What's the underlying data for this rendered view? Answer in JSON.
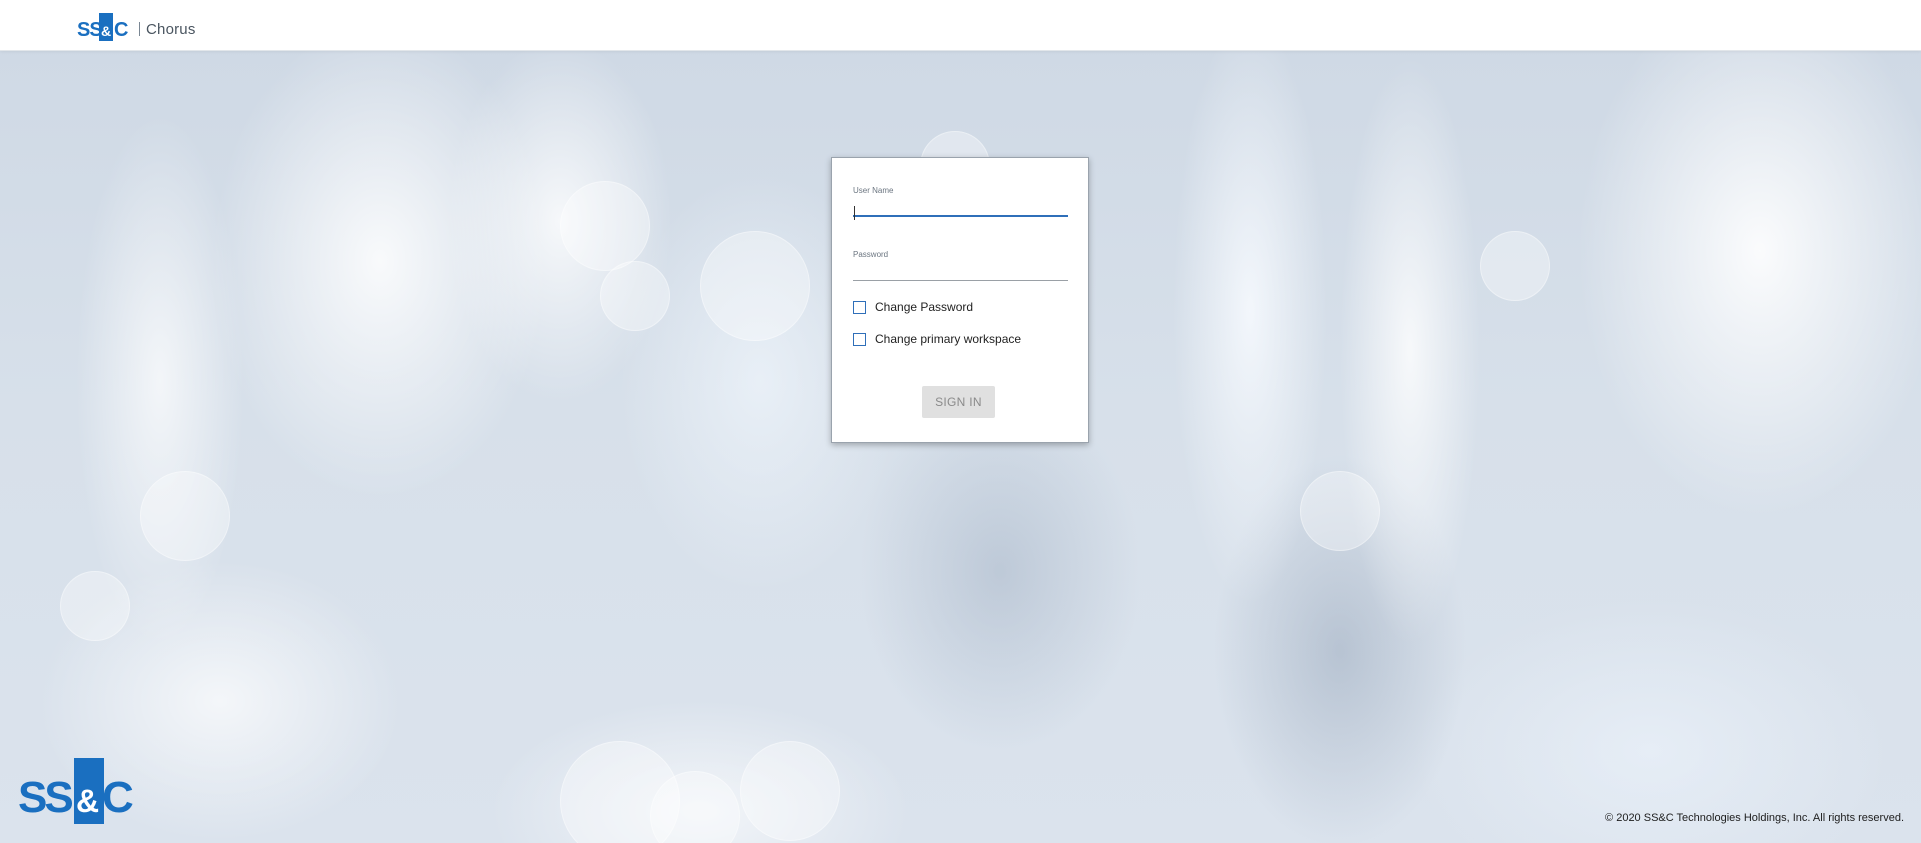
{
  "header": {
    "logo_text": "SS&C",
    "product_name": "Chorus"
  },
  "login": {
    "username_label": "User Name",
    "username_value": "",
    "password_label": "Password",
    "password_value": "",
    "change_password_label": "Change Password",
    "change_password_checked": false,
    "change_workspace_label": "Change primary workspace",
    "change_workspace_checked": false,
    "signin_label": "SIGN IN"
  },
  "footer": {
    "logo_text": "SS&C",
    "copyright": "© 2020 SS&C Technologies Holdings, Inc. All rights reserved."
  },
  "colors": {
    "brand_blue": "#1a6fc0",
    "focus_blue": "#2f6fb9",
    "button_disabled_bg": "#e0e0e0",
    "button_disabled_text": "#8a8a8a"
  },
  "icons": {
    "header_logo": "ssc-logo-icon",
    "footer_logo": "ssc-logo-icon"
  }
}
